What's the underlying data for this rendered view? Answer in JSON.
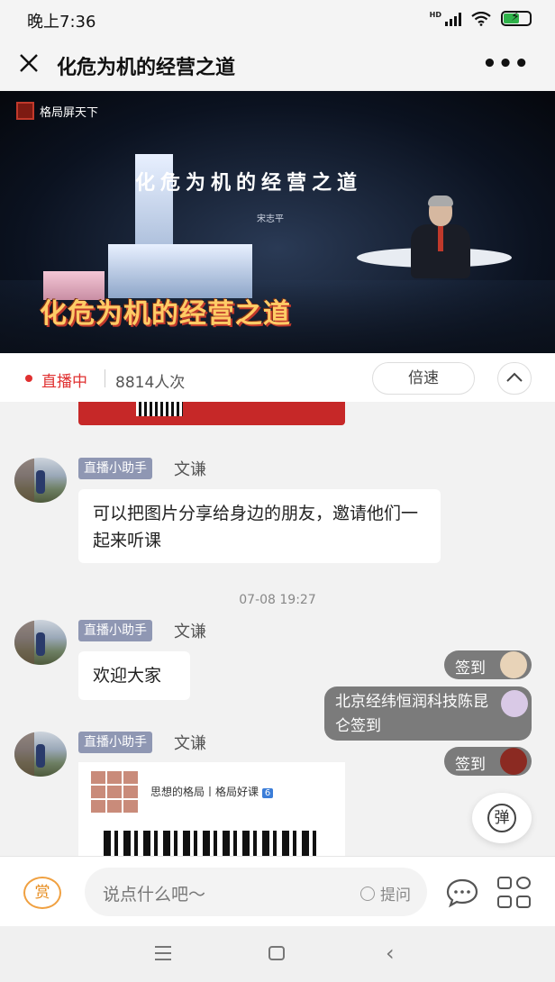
{
  "status_bar": {
    "time": "晚上7:36",
    "network": "HD"
  },
  "nav": {
    "title": "化危为机的经营之道"
  },
  "video": {
    "brand": "格局屏天下",
    "slide_title": "化危为机的经营之道",
    "speaker": "宋志平",
    "caption": "化危为机的经营之道"
  },
  "live_bar": {
    "status": "直播中",
    "views": "8814人次",
    "speed_label": "倍速"
  },
  "chat": {
    "messages": [
      {
        "badge": "直播小助手",
        "name": "文谦",
        "text": "可以把图片分享给身边的朋友，邀请他们一起来听课"
      },
      {
        "badge": "直播小助手",
        "name": "文谦",
        "text": "欢迎大家"
      },
      {
        "badge": "直播小助手",
        "name": "文谦"
      }
    ],
    "timestamp": "07-08 19:27",
    "checkins": [
      {
        "text": "签到"
      },
      {
        "text": "北京经纬恒润科技陈昆仑签到"
      },
      {
        "text": "签到"
      }
    ],
    "poster": {
      "title": "思想的格局丨格局好课",
      "badge_num": "6"
    }
  },
  "danmu_label": "弹",
  "input_bar": {
    "reward_label": "赏",
    "placeholder": "说点什么吧～",
    "ask_label": "提问"
  },
  "colors": {
    "live_red": "#e03030",
    "badge_bg": "#8f97b3",
    "checkin_bg": "#7b7b7b",
    "reward_orange": "#e68a1a"
  }
}
